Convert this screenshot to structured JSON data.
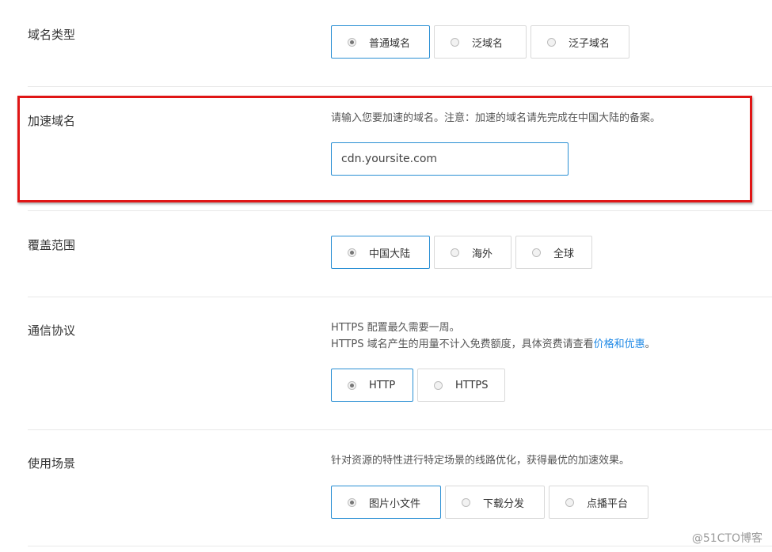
{
  "domain_type": {
    "label": "域名类型",
    "options": [
      "普通域名",
      "泛域名",
      "泛子域名"
    ],
    "selected": "普通域名"
  },
  "accel_domain": {
    "label": "加速域名",
    "description": "请输入您要加速的域名。注意：加速的域名请先完成在中国大陆的备案。",
    "input_value": "cdn.yoursite.com"
  },
  "coverage": {
    "label": "覆盖范围",
    "options": [
      "中国大陆",
      "海外",
      "全球"
    ],
    "selected": "中国大陆"
  },
  "protocol": {
    "label": "通信协议",
    "desc_line1": "HTTPS 配置最久需要一周。",
    "desc_line2_prefix": "HTTPS 域名产生的用量不计入免费额度，具体资费请查看",
    "desc_line2_link": "价格和优惠",
    "desc_line2_suffix": "。",
    "options": [
      "HTTP",
      "HTTPS"
    ],
    "selected": "HTTP"
  },
  "scenario": {
    "label": "使用场景",
    "description": "针对资源的特性进行特定场景的线路优化，获得最优的加速效果。",
    "options": [
      "图片小文件",
      "下载分发",
      "点播平台"
    ],
    "selected": "图片小文件"
  },
  "watermark": "@51CTO博客",
  "colors": {
    "accent": "#2a8fd4",
    "highlight_border": "#e01515",
    "link": "#1e88e5"
  }
}
